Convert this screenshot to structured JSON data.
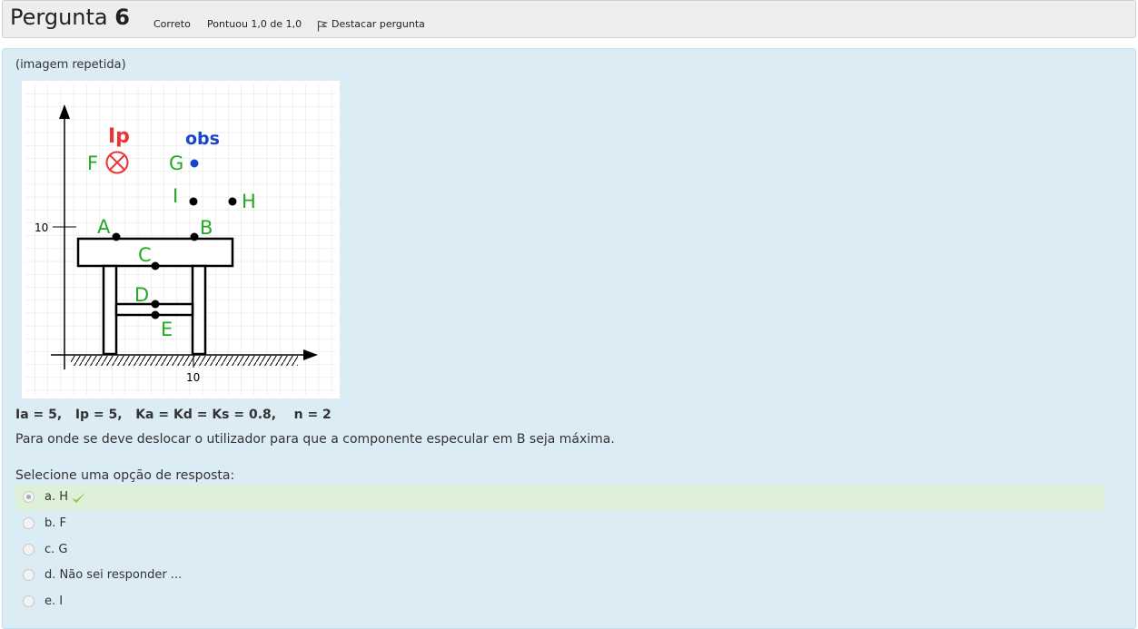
{
  "header": {
    "title_word": "Pergunta",
    "question_number": "6",
    "state": "Correto",
    "grade": "Pontuou 1,0 de 1,0",
    "flag_label": "Destacar pergunta",
    "flag_icon": "flag-icon"
  },
  "question": {
    "image_caption": "(imagem repetida)",
    "params": "Ia = 5,   Ip = 5,   Ka = Kd = Ks = 0.8,    n = 2",
    "text": "Para onde se deve deslocar o utilizador para que a componente especular em B seja máxima.",
    "prompt": "Selecione uma opção de resposta:"
  },
  "figure": {
    "labels": {
      "ip": "Ip",
      "obs": "obs",
      "F": "F",
      "G": "G",
      "I": "I",
      "H": "H",
      "A": "A",
      "B": "B",
      "C": "C",
      "D": "D",
      "E": "E",
      "tick_y": "10",
      "tick_x": "10"
    },
    "colors": {
      "light": "#ee3333",
      "observer": "#1a44cc",
      "point_labels": "#22aa22"
    }
  },
  "answers": [
    {
      "label": "a. H",
      "selected": true,
      "correct": true
    },
    {
      "label": "b. F",
      "selected": false
    },
    {
      "label": "c. G",
      "selected": false
    },
    {
      "label": "d. Não sei responder ...",
      "selected": false
    },
    {
      "label": "e. I",
      "selected": false
    }
  ],
  "colors": {
    "correct_bg": "#dff0d8",
    "check": "#8cc63f",
    "content_bg": "#dbecf5"
  }
}
